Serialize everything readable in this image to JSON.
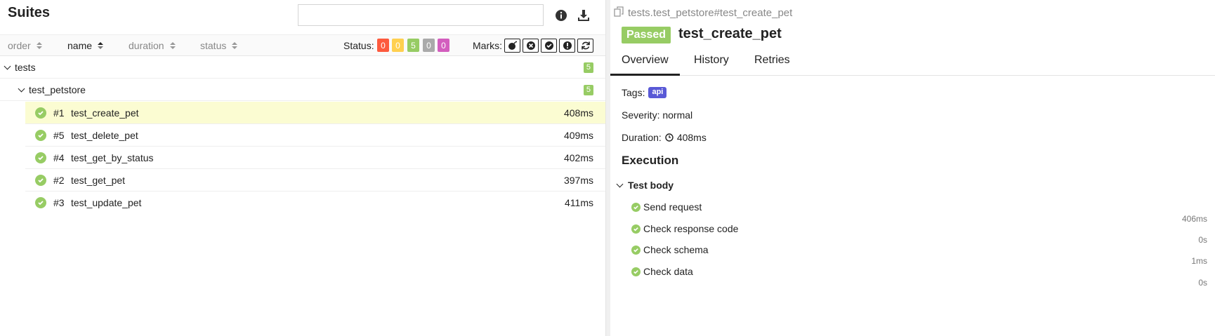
{
  "suites": {
    "title": "Suites",
    "search_placeholder": "",
    "icons": [
      "info-icon",
      "download-icon"
    ]
  },
  "sortbar": {
    "order": "order",
    "name": "name",
    "duration": "duration",
    "status": "status",
    "status_label": "Status:",
    "status_counts": [
      {
        "name": "failed",
        "count": "0",
        "color": "#fd5a3e"
      },
      {
        "name": "broken",
        "count": "0",
        "color": "#ffd050"
      },
      {
        "name": "passed",
        "count": "5",
        "color": "#97cc64"
      },
      {
        "name": "skipped",
        "count": "0",
        "color": "#aaaaaa"
      },
      {
        "name": "unknown",
        "count": "0",
        "color": "#d35ebe"
      }
    ],
    "marks_label": "Marks:",
    "marks": [
      "bomb-icon",
      "times-circle-icon",
      "check-circle-icon",
      "exclamation-circle-icon",
      "refresh-icon"
    ]
  },
  "tree": {
    "groups": [
      {
        "name": "tests",
        "count": "5"
      },
      {
        "name": "test_petstore",
        "count": "5"
      }
    ],
    "tests": [
      {
        "order": "#1",
        "name": "test_create_pet",
        "duration": "408ms"
      },
      {
        "order": "#5",
        "name": "test_delete_pet",
        "duration": "409ms"
      },
      {
        "order": "#4",
        "name": "test_get_by_status",
        "duration": "402ms"
      },
      {
        "order": "#2",
        "name": "test_get_pet",
        "duration": "397ms"
      },
      {
        "order": "#3",
        "name": "test_update_pet",
        "duration": "411ms"
      }
    ]
  },
  "detail": {
    "breadcrumb": "tests.test_petstore#test_create_pet",
    "status": "Passed",
    "title": "test_create_pet",
    "tabs": [
      "Overview",
      "History",
      "Retries"
    ],
    "tags_label": "Tags:",
    "tag": "api",
    "severity": "Severity: normal",
    "duration_label": "Duration:",
    "duration": "408ms",
    "execution_title": "Execution",
    "test_body": "Test body",
    "steps": [
      {
        "name": "Send request",
        "duration": "406ms"
      },
      {
        "name": "Check response code",
        "duration": "0s"
      },
      {
        "name": "Check schema",
        "duration": "1ms"
      },
      {
        "name": "Check data",
        "duration": "0s"
      }
    ]
  },
  "colors": {
    "passed": "#97cc64",
    "selected_row": "#fbfcd2",
    "tag": "#5959d6"
  }
}
